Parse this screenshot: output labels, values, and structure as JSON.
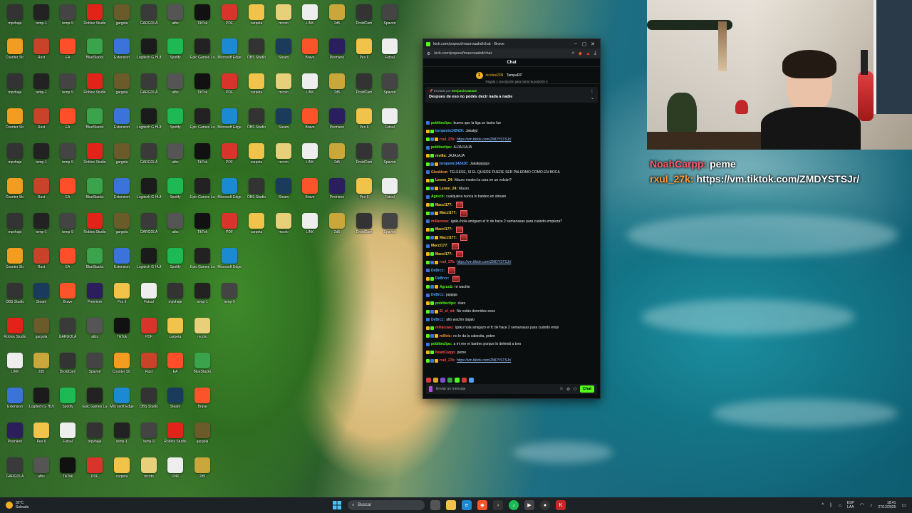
{
  "browser": {
    "window_title": "kick.com/popout/mauroaakd/chat - Brave",
    "url": "kick.com/popout/mauroaakd/chat"
  },
  "chat": {
    "heading": "Chat",
    "top_gifter": {
      "rank": "1",
      "user": "nicolas23N",
      "label": "TampaRP",
      "subtitle": "Regala 1 suscripción para tomar la posición 3"
    },
    "pinned": {
      "by_label": "Enviado por",
      "by_user": "benjamin142420",
      "message": "Despues de eso no podés decir nada a nadie"
    },
    "messages": [
      {
        "user": "pobliteclips:",
        "color": "#53fc18",
        "text": "bueno que la liga se lastra fue",
        "type": "text"
      },
      {
        "user": "benjamin142420:",
        "color": "#4fa3ff",
        "text": "Jakakjd",
        "type": "text"
      },
      {
        "user": "rxul_27k:",
        "color": "#ff4d4d",
        "text": "https://vm.tiktok.com/ZMDYSTSJr/",
        "type": "link"
      },
      {
        "user": "pobliteclips:",
        "color": "#53fc18",
        "text": "AJJAJJAJA",
        "type": "text"
      },
      {
        "user": "mvilla:",
        "color": "#ffd23f",
        "text": "JAJAJAJA",
        "type": "text"
      },
      {
        "user": "benjamin142420:",
        "color": "#4fa3ff",
        "text": "Jakakjsjsjsjs",
        "type": "text"
      },
      {
        "user": "Glenklem:",
        "color": "#ff9a3c",
        "text": "TELEESE, SI EL QUIERE PUEDE SER PALERMO COMO EN BOCA",
        "type": "text"
      },
      {
        "user": "Leonn_24:",
        "color": "#ffd23f",
        "text": "Mauro mostro la cara en un volcán?",
        "type": "text"
      },
      {
        "user": "Leonn_24:",
        "color": "#ffd23f",
        "text": "Mauro",
        "type": "text"
      },
      {
        "user": "Agrucb:",
        "color": "#53fc18",
        "text": "cualquiera nunca lo bardeo en stream",
        "type": "text"
      },
      {
        "user": "Maccl177:",
        "color": "#ffd23f",
        "text": "",
        "type": "emote"
      },
      {
        "user": "Maccl177:",
        "color": "#ffd23f",
        "text": "",
        "type": "emote"
      },
      {
        "user": "miilacuwu:",
        "color": "#ff4d4d",
        "text": "igoku hola amigazo el fc de hace 2 semanasas para cuándo empieza?",
        "type": "text"
      },
      {
        "user": "Maccl177:",
        "color": "#ffd23f",
        "text": "",
        "type": "emote"
      },
      {
        "user": "Maccl177:",
        "color": "#ffd23f",
        "text": "",
        "type": "emote"
      },
      {
        "user": "Maccl177:",
        "color": "#ffd23f",
        "text": "",
        "type": "emote"
      },
      {
        "user": "Maccl177:",
        "color": "#ffd23f",
        "text": "",
        "type": "emote"
      },
      {
        "user": "rxul_27k:",
        "color": "#ff4d4d",
        "text": "https://vm.tiktok.com/ZMDYSTSJr/",
        "type": "link"
      },
      {
        "user": "DeBrcc:",
        "color": "#4fa3ff",
        "text": "",
        "type": "emote"
      },
      {
        "user": "DeBrcc:",
        "color": "#4fa3ff",
        "text": "",
        "type": "emote"
      },
      {
        "user": "Agrucb:",
        "color": "#53fc18",
        "text": "re wachin",
        "type": "text"
      },
      {
        "user": "DeBrcc:",
        "color": "#4fa3ff",
        "text": "jajajaja",
        "type": "text"
      },
      {
        "user": "pobliteclips:",
        "color": "#53fc18",
        "text": "claro",
        "type": "text"
      },
      {
        "user": "El_el_mi:",
        "color": "#ff4d4d",
        "text": "Ne están dormidos esos",
        "type": "text"
      },
      {
        "user": "DeBrcc:",
        "color": "#4fa3ff",
        "text": "alto wachin dajalo",
        "type": "text"
      },
      {
        "user": "miilacuwu:",
        "color": "#ff4d4d",
        "text": "igoku hola amigazo el fc de hace 2 semanasas para cuándo empi",
        "type": "text"
      },
      {
        "user": "mlilvic:",
        "color": "#ff9a3c",
        "text": "no le da la cabecita, pobre",
        "type": "text"
      },
      {
        "user": "pobliteclips:",
        "color": "#53fc18",
        "text": "a mi me re bardeo porque lo defendi a toro",
        "type": "text"
      },
      {
        "user": "NoahCarpp:",
        "color": "#ff4d4d",
        "text": "peme",
        "type": "text"
      },
      {
        "user": "rxul_27k:",
        "color": "#ff4d4d",
        "text": "https://vm.tiktok.com/ZMDYSTSJr/",
        "type": "link"
      }
    ],
    "input_placeholder": "Enviar un mensaje",
    "send_label": "Chat"
  },
  "overlay": [
    {
      "user": "NoahCarpp:",
      "user_color": "#ff5a6b",
      "text": "peme",
      "text_color": "#ffffff"
    },
    {
      "user": "rxul_27k:",
      "user_color": "#ff9a3c",
      "text": "https://vm.tiktok.com/ZMDYSTSJr/",
      "text_color": "#ffffff"
    }
  ],
  "desktop_icons": [
    {
      "label": "mpvhaje",
      "color": "#333"
    },
    {
      "label": "temp-1",
      "color": "#222"
    },
    {
      "label": "temp-9",
      "color": "#444"
    },
    {
      "label": "Roblox Studio",
      "color": "#e2231a"
    },
    {
      "label": "gargola",
      "color": "#6b5a2a"
    },
    {
      "label": "GARGOLA",
      "color": "#3a3a3a"
    },
    {
      "label": "atbs",
      "color": "#555"
    },
    {
      "label": "TikTok",
      "color": "#111"
    },
    {
      "label": "PDF",
      "color": "#d9342b"
    },
    {
      "label": "carpeta",
      "color": "#f2c34b"
    },
    {
      "label": "mcoto",
      "color": "#e8d07a"
    },
    {
      "label": "LINK",
      "color": "#eee"
    },
    {
      "label": "2d5",
      "color": "#c9a73a"
    },
    {
      "label": "DroidCam",
      "color": "#333"
    },
    {
      "label": "Spavon",
      "color": "#444"
    },
    {
      "label": "Counter Str.",
      "color": "#f29d1f"
    },
    {
      "label": "Rust",
      "color": "#c8432a"
    },
    {
      "label": "EA",
      "color": "#ff4f2a"
    },
    {
      "label": "BlueStacks",
      "color": "#3aa34c"
    },
    {
      "label": "Extension",
      "color": "#3a73d9"
    },
    {
      "label": "Logitech G HUB",
      "color": "#1b1b1b"
    },
    {
      "label": "Spotify",
      "color": "#1db954"
    },
    {
      "label": "Epic Games Launcher",
      "color": "#222"
    },
    {
      "label": "Microsoft Edge",
      "color": "#1b8ad3"
    },
    {
      "label": "OBS Studio",
      "color": "#333"
    },
    {
      "label": "Steam",
      "color": "#1a3b5c"
    },
    {
      "label": "Brave",
      "color": "#fb542b"
    },
    {
      "label": "Premiere",
      "color": "#2a1f5c"
    },
    {
      "label": "Pes 6",
      "color": "#f2c34b"
    },
    {
      "label": "Futsal",
      "color": "#eee"
    }
  ],
  "webcam": {
    "scene": "streamer-webcam"
  },
  "taskbar": {
    "weather_temp": "32°C",
    "weather_desc": "Soleado",
    "search_label": "Buscar",
    "lang_top": "ESP",
    "lang_bottom": "LAA",
    "time": "18:41",
    "date": "27/12/2025",
    "app_icons": [
      "windows-icon",
      "file-explorer-icon",
      "edge-icon",
      "brave-icon",
      "spotify-icon",
      "terminal-icon",
      "obs-icon",
      "chrome-icon",
      "kick-icon"
    ]
  }
}
